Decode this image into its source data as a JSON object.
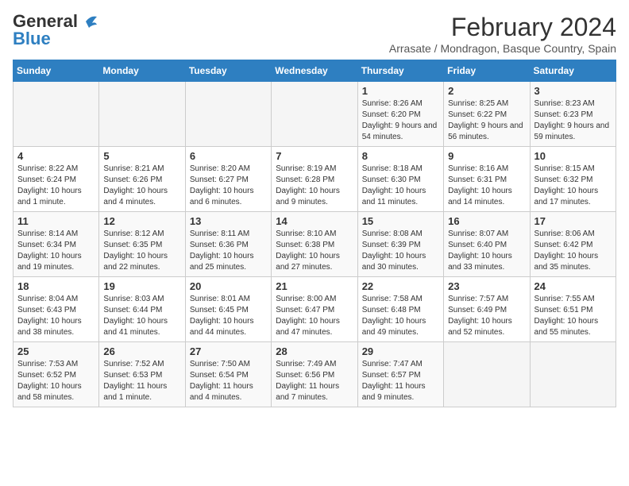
{
  "header": {
    "logo_general": "General",
    "logo_blue": "Blue",
    "month": "February 2024",
    "location": "Arrasate / Mondragon, Basque Country, Spain"
  },
  "days_of_week": [
    "Sunday",
    "Monday",
    "Tuesday",
    "Wednesday",
    "Thursday",
    "Friday",
    "Saturday"
  ],
  "weeks": [
    [
      {
        "day": "",
        "info": ""
      },
      {
        "day": "",
        "info": ""
      },
      {
        "day": "",
        "info": ""
      },
      {
        "day": "",
        "info": ""
      },
      {
        "day": "1",
        "info": "Sunrise: 8:26 AM\nSunset: 6:20 PM\nDaylight: 9 hours and 54 minutes."
      },
      {
        "day": "2",
        "info": "Sunrise: 8:25 AM\nSunset: 6:22 PM\nDaylight: 9 hours and 56 minutes."
      },
      {
        "day": "3",
        "info": "Sunrise: 8:23 AM\nSunset: 6:23 PM\nDaylight: 9 hours and 59 minutes."
      }
    ],
    [
      {
        "day": "4",
        "info": "Sunrise: 8:22 AM\nSunset: 6:24 PM\nDaylight: 10 hours and 1 minute."
      },
      {
        "day": "5",
        "info": "Sunrise: 8:21 AM\nSunset: 6:26 PM\nDaylight: 10 hours and 4 minutes."
      },
      {
        "day": "6",
        "info": "Sunrise: 8:20 AM\nSunset: 6:27 PM\nDaylight: 10 hours and 6 minutes."
      },
      {
        "day": "7",
        "info": "Sunrise: 8:19 AM\nSunset: 6:28 PM\nDaylight: 10 hours and 9 minutes."
      },
      {
        "day": "8",
        "info": "Sunrise: 8:18 AM\nSunset: 6:30 PM\nDaylight: 10 hours and 11 minutes."
      },
      {
        "day": "9",
        "info": "Sunrise: 8:16 AM\nSunset: 6:31 PM\nDaylight: 10 hours and 14 minutes."
      },
      {
        "day": "10",
        "info": "Sunrise: 8:15 AM\nSunset: 6:32 PM\nDaylight: 10 hours and 17 minutes."
      }
    ],
    [
      {
        "day": "11",
        "info": "Sunrise: 8:14 AM\nSunset: 6:34 PM\nDaylight: 10 hours and 19 minutes."
      },
      {
        "day": "12",
        "info": "Sunrise: 8:12 AM\nSunset: 6:35 PM\nDaylight: 10 hours and 22 minutes."
      },
      {
        "day": "13",
        "info": "Sunrise: 8:11 AM\nSunset: 6:36 PM\nDaylight: 10 hours and 25 minutes."
      },
      {
        "day": "14",
        "info": "Sunrise: 8:10 AM\nSunset: 6:38 PM\nDaylight: 10 hours and 27 minutes."
      },
      {
        "day": "15",
        "info": "Sunrise: 8:08 AM\nSunset: 6:39 PM\nDaylight: 10 hours and 30 minutes."
      },
      {
        "day": "16",
        "info": "Sunrise: 8:07 AM\nSunset: 6:40 PM\nDaylight: 10 hours and 33 minutes."
      },
      {
        "day": "17",
        "info": "Sunrise: 8:06 AM\nSunset: 6:42 PM\nDaylight: 10 hours and 35 minutes."
      }
    ],
    [
      {
        "day": "18",
        "info": "Sunrise: 8:04 AM\nSunset: 6:43 PM\nDaylight: 10 hours and 38 minutes."
      },
      {
        "day": "19",
        "info": "Sunrise: 8:03 AM\nSunset: 6:44 PM\nDaylight: 10 hours and 41 minutes."
      },
      {
        "day": "20",
        "info": "Sunrise: 8:01 AM\nSunset: 6:45 PM\nDaylight: 10 hours and 44 minutes."
      },
      {
        "day": "21",
        "info": "Sunrise: 8:00 AM\nSunset: 6:47 PM\nDaylight: 10 hours and 47 minutes."
      },
      {
        "day": "22",
        "info": "Sunrise: 7:58 AM\nSunset: 6:48 PM\nDaylight: 10 hours and 49 minutes."
      },
      {
        "day": "23",
        "info": "Sunrise: 7:57 AM\nSunset: 6:49 PM\nDaylight: 10 hours and 52 minutes."
      },
      {
        "day": "24",
        "info": "Sunrise: 7:55 AM\nSunset: 6:51 PM\nDaylight: 10 hours and 55 minutes."
      }
    ],
    [
      {
        "day": "25",
        "info": "Sunrise: 7:53 AM\nSunset: 6:52 PM\nDaylight: 10 hours and 58 minutes."
      },
      {
        "day": "26",
        "info": "Sunrise: 7:52 AM\nSunset: 6:53 PM\nDaylight: 11 hours and 1 minute."
      },
      {
        "day": "27",
        "info": "Sunrise: 7:50 AM\nSunset: 6:54 PM\nDaylight: 11 hours and 4 minutes."
      },
      {
        "day": "28",
        "info": "Sunrise: 7:49 AM\nSunset: 6:56 PM\nDaylight: 11 hours and 7 minutes."
      },
      {
        "day": "29",
        "info": "Sunrise: 7:47 AM\nSunset: 6:57 PM\nDaylight: 11 hours and 9 minutes."
      },
      {
        "day": "",
        "info": ""
      },
      {
        "day": "",
        "info": ""
      }
    ]
  ]
}
